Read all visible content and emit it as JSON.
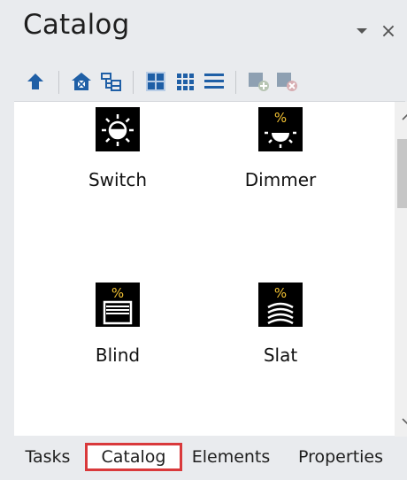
{
  "window": {
    "title": "Catalog"
  },
  "title_buttons": {
    "dropdown_icon": "chevron-down-icon",
    "close_label": "×"
  },
  "toolbar": [
    {
      "icon": "up-arrow-icon"
    },
    {
      "icon": "home-icon"
    },
    {
      "icon": "tree-icon"
    },
    {
      "icon": "large-icons-view-icon"
    },
    {
      "icon": "small-icons-view-icon"
    },
    {
      "icon": "list-view-icon"
    },
    {
      "icon": "add-item-icon"
    },
    {
      "icon": "remove-item-icon"
    }
  ],
  "catalog": {
    "items": [
      {
        "label": "Switch",
        "icon": "light-switch-icon"
      },
      {
        "label": "Dimmer",
        "icon": "dimmer-icon",
        "badge": "%"
      },
      {
        "label": "Blind",
        "icon": "blind-icon",
        "badge": "%"
      },
      {
        "label": "Slat",
        "icon": "slat-icon",
        "badge": "%"
      }
    ]
  },
  "tabs": [
    {
      "label": "Tasks",
      "active": false
    },
    {
      "label": "Catalog",
      "active": true
    },
    {
      "label": "Elements",
      "active": false
    },
    {
      "label": "Properties",
      "active": false
    }
  ],
  "colors": {
    "panel_bg": "#e9ebee",
    "content_bg": "#ffffff",
    "toolbar_icon": "#1f5fa6",
    "active_tab_border": "#d9393b",
    "badge_yellow": "#f3c233",
    "icon_bg": "#000000"
  }
}
